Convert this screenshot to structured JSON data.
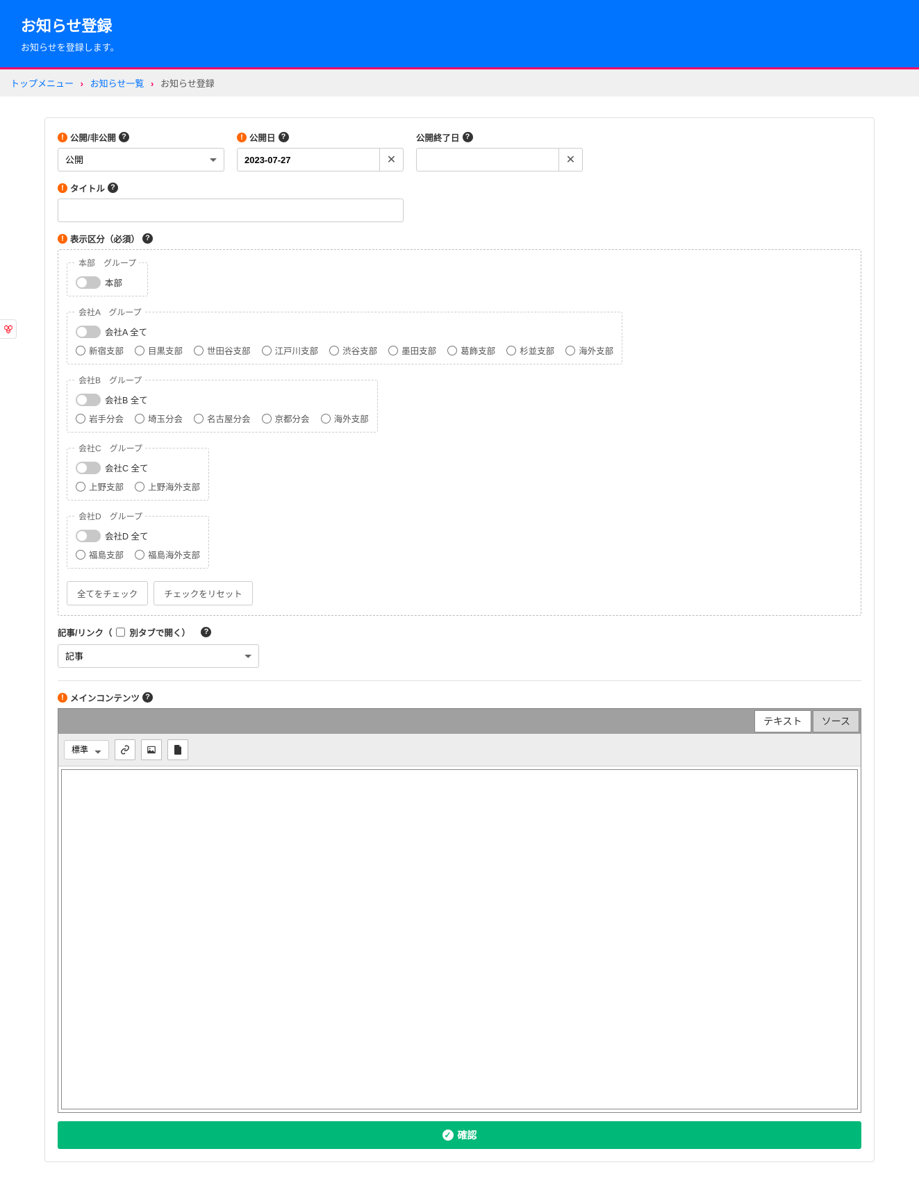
{
  "header": {
    "title": "お知らせ登録",
    "subtitle": "お知らせを登録します。"
  },
  "breadcrumb": {
    "items": [
      "トップメニュー",
      "お知らせ一覧"
    ],
    "current": "お知らせ登録"
  },
  "fields": {
    "visibility": {
      "label": "公開/非公開",
      "value": "公開"
    },
    "publish_date": {
      "label": "公開日",
      "value": "2023-07-27"
    },
    "end_date": {
      "label": "公開終了日",
      "value": ""
    },
    "title": {
      "label": "タイトル",
      "value": ""
    },
    "display_section": {
      "label": "表示区分（必須）"
    },
    "article_link": {
      "label": "記事/リンク（",
      "checkbox_label": "別タブで開く）",
      "value": "記事"
    },
    "main_content": {
      "label": "メインコンテンツ"
    }
  },
  "groups": [
    {
      "legend": "本部　グループ",
      "toggle": "本部",
      "items": []
    },
    {
      "legend": "会社A　グループ",
      "toggle": "会社A 全て",
      "items": [
        "新宿支部",
        "目黒支部",
        "世田谷支部",
        "江戸川支部",
        "渋谷支部",
        "墨田支部",
        "葛飾支部",
        "杉並支部",
        "海外支部"
      ]
    },
    {
      "legend": "会社B　グループ",
      "toggle": "会社B 全て",
      "items": [
        "岩手分会",
        "埼玉分会",
        "名古屋分会",
        "京都分会",
        "海外支部"
      ]
    },
    {
      "legend": "会社C　グループ",
      "toggle": "会社C 全て",
      "items": [
        "上野支部",
        "上野海外支部"
      ]
    },
    {
      "legend": "会社D　グループ",
      "toggle": "会社D 全て",
      "items": [
        "福島支部",
        "福島海外支部"
      ]
    }
  ],
  "buttons": {
    "check_all": "全てをチェック",
    "reset_check": "チェックをリセット",
    "confirm": "確認"
  },
  "editor": {
    "tabs": [
      "テキスト",
      "ソース"
    ],
    "format_options": [
      "標準"
    ]
  }
}
